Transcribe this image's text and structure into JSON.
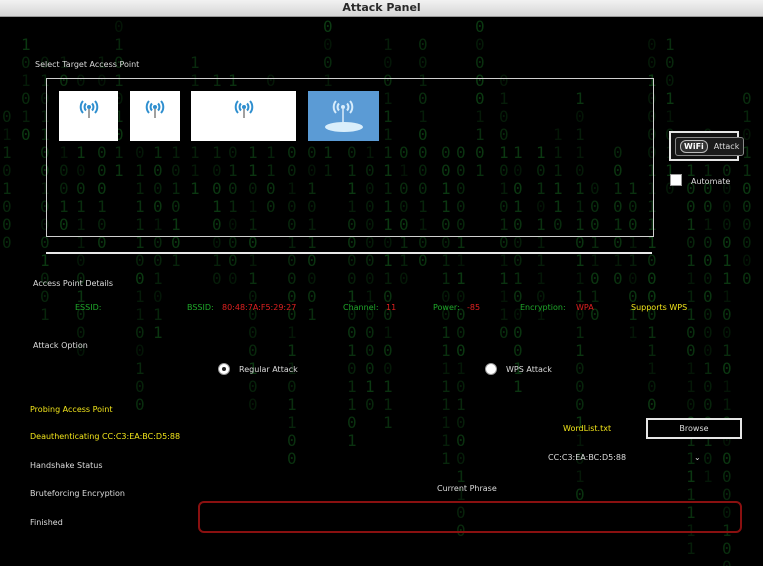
{
  "window": {
    "title": "Attack Panel"
  },
  "target": {
    "section_label": "Select Target Access Point",
    "access_points": [
      {
        "icon": "wifi-tower-icon"
      },
      {
        "icon": "wifi-tower-icon"
      },
      {
        "icon": "wifi-tower-icon"
      },
      {
        "icon": "wifi-tower-icon",
        "selected": true
      }
    ]
  },
  "actions": {
    "attack_label": "Attack",
    "attack_logo": "WiFi",
    "automate_label": "Automate"
  },
  "details": {
    "section_label": "Access Point Details",
    "essid_label": "ESSID:",
    "essid_value": "",
    "bssid_label": "BSSID:",
    "bssid_value": "80:48:7A:F5:29:27",
    "channel_label": "Channel:",
    "channel_value": "11",
    "power_label": "Power:",
    "power_value": "-85",
    "encryption_label": "Encryption:",
    "encryption_value": "WPA",
    "wps_text": "Supports WPS"
  },
  "attack_option": {
    "section_label": "Attack Option",
    "regular_label": "Regular Attack",
    "wps_label": "WPS  Attack",
    "selected": "regular"
  },
  "progress": {
    "probing": "Probing Access Point",
    "deauth": "Deauthenticating CC:C3:EA:BC:D5:88",
    "handshake": "Handshake Status",
    "bruteforce": "Bruteforcing Encryption",
    "finished": "Finished"
  },
  "wordlist": {
    "filename": "WordList.txt",
    "browse_label": "Browse"
  },
  "client_select": {
    "value": "CC:C3:EA:BC:D5:88"
  },
  "phrase": {
    "label": "Current Phrase",
    "value": ""
  },
  "colors": {
    "background": "#000000",
    "matrix_green": "#0c3a12",
    "status_yellow": "#f2e51a",
    "value_red": "#e02020",
    "label_green": "#1fa82a",
    "phrase_border": "#8a1010"
  }
}
